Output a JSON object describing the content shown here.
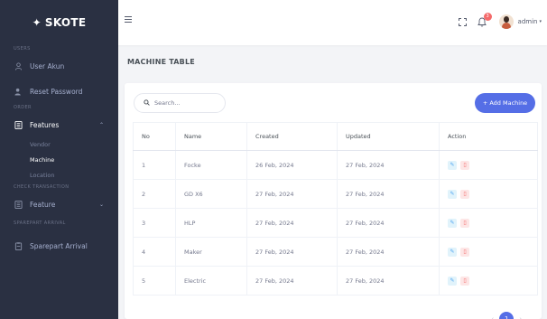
{
  "brand": {
    "name": "SKOTE",
    "logo_icon": "skote-logo-icon"
  },
  "sidebar": {
    "sections": [
      {
        "title": "USERS",
        "items": [
          {
            "label": "User Akun",
            "icon": "user-icon"
          },
          {
            "label": "Reset Password",
            "icon": "user-lock-icon"
          }
        ]
      },
      {
        "title": "ORDER",
        "items": [
          {
            "label": "Features",
            "icon": "features-icon",
            "expanded": true,
            "children": [
              {
                "label": "Vendor"
              },
              {
                "label": "Machine",
                "active": true
              },
              {
                "label": "Location"
              }
            ]
          }
        ]
      },
      {
        "title": "CHECK TRANSACTION",
        "items": [
          {
            "label": "Feature",
            "icon": "feature-icon"
          }
        ]
      },
      {
        "title": "SPAREPART ARRIVAL",
        "items": [
          {
            "label": "Sparepart Arrival",
            "icon": "sparepart-icon"
          }
        ]
      }
    ]
  },
  "topbar": {
    "notification_count": "3",
    "user_name": "admin"
  },
  "page": {
    "title": "MACHINE TABLE"
  },
  "toolbar": {
    "search_placeholder": "Search...",
    "add_label": "+ Add Machine"
  },
  "table": {
    "columns": [
      "No",
      "Name",
      "Created",
      "Updated",
      "Action"
    ],
    "rows": [
      {
        "no": "1",
        "name": "Focke",
        "created": "26 Feb, 2024",
        "updated": "27 Feb, 2024"
      },
      {
        "no": "2",
        "name": "GD X6",
        "created": "27 Feb, 2024",
        "updated": "27 Feb, 2024"
      },
      {
        "no": "3",
        "name": "HLP",
        "created": "27 Feb, 2024",
        "updated": "27 Feb, 2024"
      },
      {
        "no": "4",
        "name": "Maker",
        "created": "27 Feb, 2024",
        "updated": "27 Feb, 2024"
      },
      {
        "no": "5",
        "name": "Electric",
        "created": "27 Feb, 2024",
        "updated": "27 Feb, 2024"
      }
    ]
  },
  "pagination": {
    "current": "1"
  },
  "colors": {
    "sidebar": "#2a3042",
    "primary": "#556ee6",
    "danger": "#f46a6a",
    "info": "#50a5f1"
  }
}
